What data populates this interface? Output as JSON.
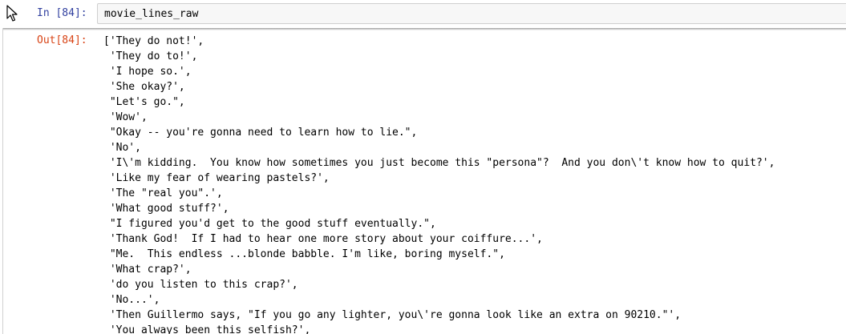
{
  "input_cell": {
    "prompt": "In [84]:",
    "code": "movie_lines_raw"
  },
  "output_cell": {
    "prompt": "Out[84]:",
    "lines": [
      "['They do not!',",
      " 'They do to!',",
      " 'I hope so.',",
      " 'She okay?',",
      " \"Let's go.\",",
      " 'Wow',",
      " \"Okay -- you're gonna need to learn how to lie.\",",
      " 'No',",
      " 'I\\'m kidding.  You know how sometimes you just become this \"persona\"?  And you don\\'t know how to quit?',",
      " 'Like my fear of wearing pastels?',",
      " 'The \"real you\".',",
      " 'What good stuff?',",
      " \"I figured you'd get to the good stuff eventually.\",",
      " 'Thank God!  If I had to hear one more story about your coiffure...',",
      " \"Me.  This endless ...blonde babble. I'm like, boring myself.\",",
      " 'What crap?',",
      " 'do you listen to this crap?',",
      " 'No...',",
      " 'Then Guillermo says, \"If you go any lighter, you\\'re gonna look like an extra on 90210.\"',",
      " 'You always been this selfish?',"
    ]
  }
}
